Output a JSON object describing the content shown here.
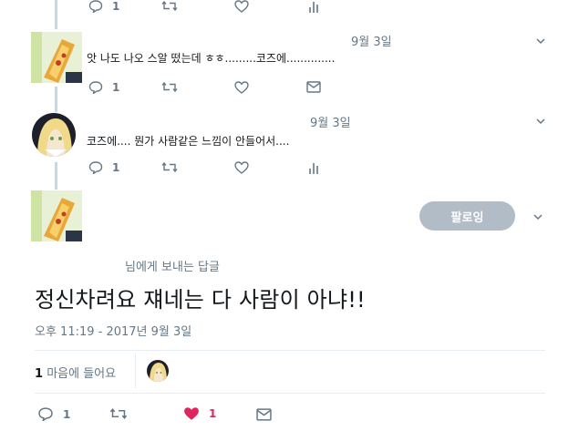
{
  "tweets": [
    {
      "date": "",
      "text": "",
      "reply_count": "1",
      "actions": [
        "reply-icon",
        "retweet-icon",
        "heart-icon",
        "analytics-icon"
      ]
    },
    {
      "date": "9월 3일",
      "text": "앗 나도 나오 스알 떴는데 ㅎㅎ.........코즈에..............",
      "reply_count": "1",
      "actions": [
        "reply-icon",
        "retweet-icon",
        "heart-icon",
        "dm-icon"
      ]
    },
    {
      "date": "9월 3일",
      "text": "코즈에.... 뭔가 사람같은 느낌이 안들어서....",
      "reply_count": "1",
      "actions": [
        "reply-icon",
        "retweet-icon",
        "heart-icon",
        "analytics-icon"
      ]
    }
  ],
  "focused_tweet": {
    "follow_label": "팔로잉",
    "reply_to": "님에게 보내는 답글",
    "text": "정신차려요 쟤네는 다 사람이 아냐!!",
    "timestamp": "오후 11:19 - 2017년 9월 3일",
    "likes_count": "1",
    "likes_label": "마음에 들어요",
    "reply_count": "1",
    "heart_count": "1"
  },
  "colors": {
    "accent_like": "#e0245e",
    "follow_button": "#b1bcc6",
    "secondary_text": "#657786"
  }
}
